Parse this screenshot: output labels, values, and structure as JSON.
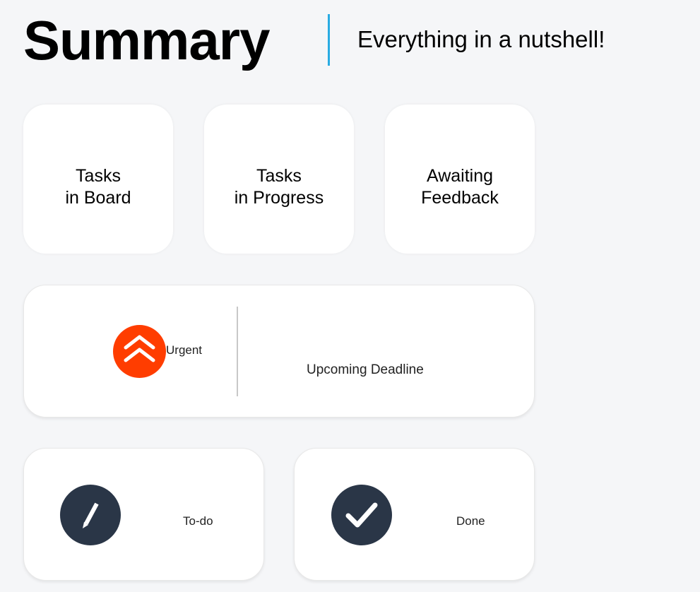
{
  "header": {
    "title": "Summary",
    "subtitle": "Everything in a nutshell!"
  },
  "stats": {
    "board_label": "Tasks\nin Board",
    "progress_label": "Tasks\nin Progress",
    "feedback_label": "Awaiting\nFeedback"
  },
  "urgent": {
    "label": "Urgent",
    "icon": "double-chevron-up-icon",
    "color": "#ff3d00"
  },
  "deadline": {
    "label": "Upcoming Deadline"
  },
  "todo": {
    "label": "To-do",
    "icon": "pencil-icon"
  },
  "done": {
    "label": "Done",
    "icon": "checkmark-icon"
  },
  "colors": {
    "accent": "#29abe2",
    "icon_bg": "#2a3647",
    "background": "#f5f6f8"
  }
}
